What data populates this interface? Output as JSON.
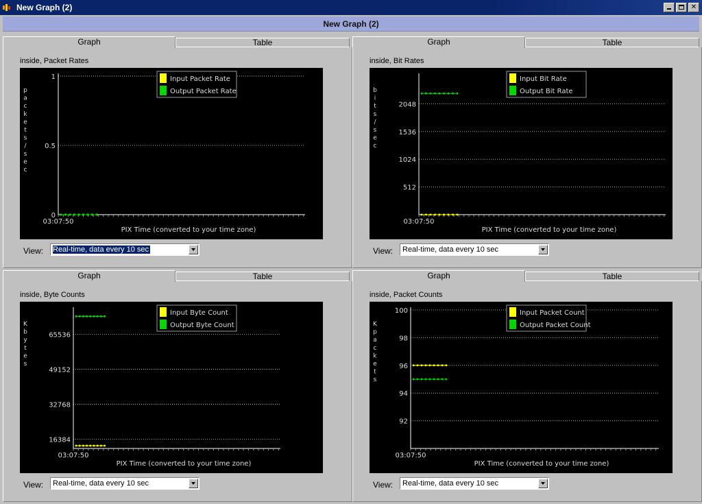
{
  "window": {
    "title": "New Graph (2)"
  },
  "header": {
    "title": "New Graph (2)"
  },
  "tabs": {
    "graph": "Graph",
    "table": "Table"
  },
  "view": {
    "label": "View:",
    "selected": "Real-time, data every 10 sec"
  },
  "colors": {
    "input": "#ffff00",
    "output": "#00d800",
    "grid": "#b0b0b0",
    "axis": "#ffffff"
  },
  "panels": [
    {
      "title": "inside, Packet Rates",
      "chart_data": {
        "type": "line",
        "ylabel": "packets/sec",
        "xlabel": "PIX Time (converted to your time zone)",
        "x_tick": "03:07:50",
        "ylim": [
          0,
          1
        ],
        "yticks": [
          "0",
          "0.5",
          "1"
        ],
        "series": [
          {
            "name": "Input Packet Rate",
            "values": [
              0,
              0,
              0,
              0,
              0,
              0,
              0,
              0,
              0
            ]
          },
          {
            "name": "Output Packet Rate",
            "values": [
              0,
              0,
              0,
              0,
              0,
              0,
              0,
              0,
              0
            ]
          }
        ]
      }
    },
    {
      "title": "inside, Bit Rates",
      "chart_data": {
        "type": "line",
        "ylabel": "bits/sec",
        "xlabel": "PIX Time (converted to your time zone)",
        "x_tick": "03:07:50",
        "ylim": [
          0,
          2560
        ],
        "yticks": [
          "512",
          "1024",
          "1536",
          "2048"
        ],
        "series": [
          {
            "name": "Input Bit Rate",
            "values": [
              0,
              0,
              0,
              0,
              0,
              0,
              0,
              0,
              0
            ]
          },
          {
            "name": "Output Bit Rate",
            "values": [
              2240,
              2240,
              2240,
              2240,
              2240,
              2240,
              2240,
              2240,
              2240
            ]
          }
        ]
      }
    },
    {
      "title": "inside, Byte Counts",
      "chart_data": {
        "type": "line",
        "ylabel": "Kbytes",
        "xlabel": "PIX Time (converted to your time zone)",
        "x_tick": "03:07:50",
        "ylim": [
          12000,
          77000
        ],
        "yticks": [
          "16384",
          "32768",
          "49152",
          "65536"
        ],
        "series": [
          {
            "name": "Input Byte Count",
            "values": [
              13300,
              13300,
              13300,
              13300,
              13300,
              13300,
              13300,
              13300,
              13300
            ]
          },
          {
            "name": "Output Byte Count",
            "values": [
              74000,
              74000,
              74000,
              74000,
              74000,
              74000,
              74000,
              74000,
              74000
            ]
          }
        ]
      }
    },
    {
      "title": "inside, Packet Counts",
      "chart_data": {
        "type": "line",
        "ylabel": "Kpackets",
        "xlabel": "PIX Time (converted to your time zone)",
        "x_tick": "03:07:50",
        "ylim": [
          90,
          100
        ],
        "yticks": [
          "92",
          "94",
          "96",
          "98",
          "100"
        ],
        "series": [
          {
            "name": "Input Packet Count",
            "values": [
              96,
              96,
              96,
              96,
              96,
              96,
              96,
              96,
              96
            ]
          },
          {
            "name": "Output Packet Count",
            "values": [
              95,
              95,
              95,
              95,
              95,
              95,
              95,
              95,
              95
            ]
          }
        ]
      }
    }
  ]
}
